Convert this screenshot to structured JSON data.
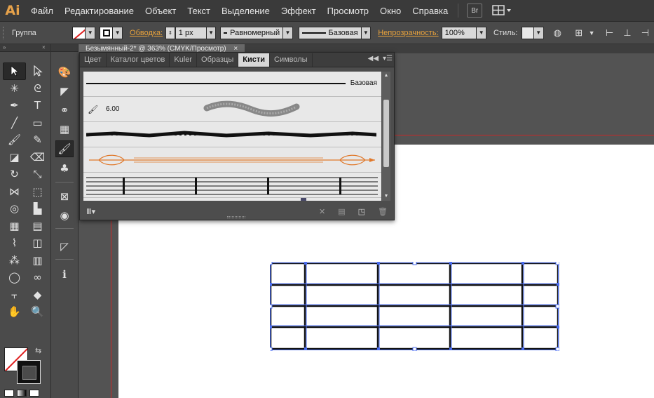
{
  "app": {
    "logo": "Ai"
  },
  "menu": {
    "items": [
      "Файл",
      "Редактирование",
      "Объект",
      "Текст",
      "Выделение",
      "Эффект",
      "Просмотр",
      "Окно",
      "Справка"
    ],
    "bridge_label": "Br"
  },
  "controlbar": {
    "selection_label": "Группа",
    "stroke_link": "Обводка:",
    "stroke_weight": "1 px",
    "profile_value": "Равномерный",
    "brush_value": "Базовая",
    "opacity_link": "Непрозрачность:",
    "opacity_value": "100%",
    "style_label": "Стиль:"
  },
  "document": {
    "tab_title": "Безымянный-2* @ 363% (CMYK/Просмотр)"
  },
  "brushes_panel": {
    "tabs": [
      "Цвет",
      "Каталог цветов",
      "Kuler",
      "Образцы",
      "Кисти",
      "Символы"
    ],
    "active_tab": "Кисти",
    "brushes": [
      {
        "type": "basic",
        "name": "Базовая"
      },
      {
        "type": "bristle",
        "size": "6.00"
      },
      {
        "type": "art-charcoal"
      },
      {
        "type": "art-arrow"
      },
      {
        "type": "pattern-staff"
      },
      {
        "type": "pattern-border"
      }
    ]
  },
  "colors": {
    "accent_link": "#e8a23c",
    "guide_red": "#c82828",
    "selection_blue": "#4a6cf0",
    "arrow_orange": "#e0782a"
  },
  "icons": {
    "tools": [
      "selection-tool-icon",
      "direct-selection-tool-icon",
      "magic-wand-tool-icon",
      "lasso-tool-icon",
      "pen-tool-icon",
      "type-tool-icon",
      "line-segment-tool-icon",
      "rectangle-tool-icon",
      "paintbrush-tool-icon",
      "pencil-tool-icon",
      "blob-brush-tool-icon",
      "eraser-tool-icon",
      "rotate-tool-icon",
      "scale-tool-icon",
      "width-tool-icon",
      "free-transform-tool-icon",
      "shape-builder-tool-icon",
      "perspective-grid-tool-icon",
      "mesh-tool-icon",
      "gradient-tool-icon",
      "eyedropper-tool-icon",
      "blend-tool-icon",
      "symbol-sprayer-tool-icon",
      "column-graph-tool-icon",
      "artboard-tool-icon",
      "slice-tool-icon",
      "hand-tool-icon",
      "zoom-tool-icon"
    ]
  }
}
